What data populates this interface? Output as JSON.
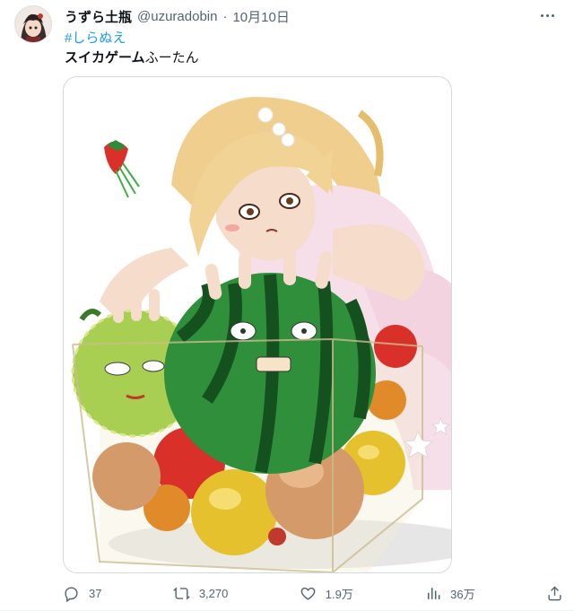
{
  "tweet": {
    "display_name": "うずら土瓶",
    "handle": "@uzuradobin",
    "separator": "·",
    "date": "10月10日",
    "hashtag": "#しらぬえ",
    "text_bold": "スイカゲーム",
    "text_rest": "ふーたん"
  },
  "actions": {
    "replies": "37",
    "retweets": "3,270",
    "likes": "1.9万",
    "views": "36万"
  },
  "icons": {
    "more": "more-horizontal-icon",
    "reply": "reply-icon",
    "retweet": "retweet-icon",
    "like": "like-icon",
    "views": "views-icon",
    "share": "share-icon"
  },
  "colors": {
    "link": "#1d9bf0",
    "secondary_text": "#536471",
    "primary_text": "#0f1419"
  }
}
